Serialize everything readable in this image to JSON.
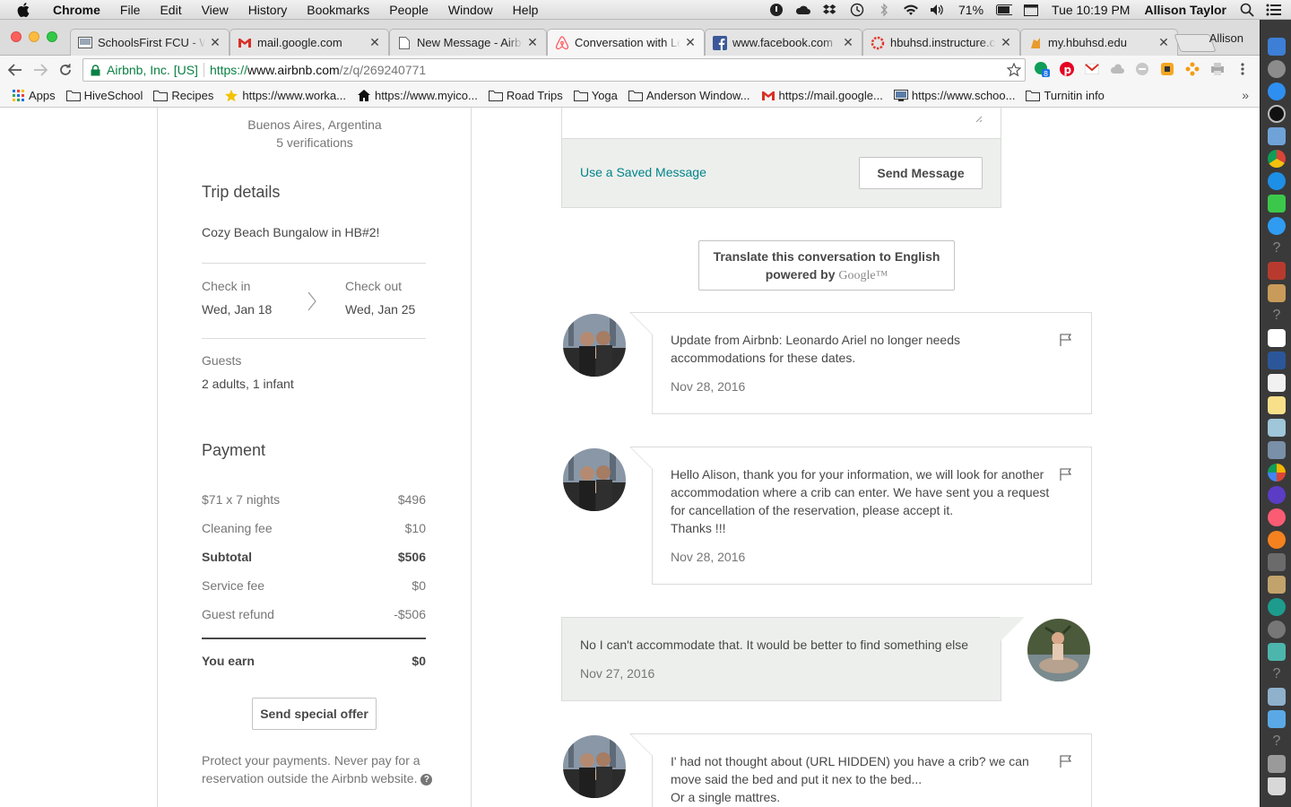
{
  "menubar": {
    "app": "Chrome",
    "items": [
      "File",
      "Edit",
      "View",
      "History",
      "Bookmarks",
      "People",
      "Window",
      "Help"
    ],
    "battery": "71%",
    "clock": "Tue 10:19 PM",
    "user": "Allison Taylor"
  },
  "tabs": [
    {
      "title": "SchoolsFirst FCU - W",
      "icon": "schoolsfirst-icon"
    },
    {
      "title": "mail.google.com",
      "icon": "gmail-icon"
    },
    {
      "title": "New Message - Airbnb",
      "icon": "document-icon"
    },
    {
      "title": "Conversation with Leonardo",
      "icon": "airbnb-icon",
      "active": true
    },
    {
      "title": "www.facebook.com",
      "icon": "facebook-icon"
    },
    {
      "title": "hbuhsd.instructure.com",
      "icon": "canvas-icon"
    },
    {
      "title": "my.hbuhsd.edu",
      "icon": "hbuhsd-icon"
    }
  ],
  "profile_name": "Allison",
  "address": {
    "org": "Airbnb, Inc. [US]",
    "scheme": "https://",
    "host": "www.airbnb.com",
    "path": "/z/q/269240771"
  },
  "bookmarks": [
    {
      "label": "Apps",
      "icon": "apps-grid-icon"
    },
    {
      "label": "HiveSchool",
      "icon": "folder-icon"
    },
    {
      "label": "Recipes",
      "icon": "folder-icon"
    },
    {
      "label": "https://www.worka...",
      "icon": "star-badge-icon"
    },
    {
      "label": "https://www.myico...",
      "icon": "house-icon"
    },
    {
      "label": "Road Trips",
      "icon": "folder-icon"
    },
    {
      "label": "Yoga",
      "icon": "folder-icon"
    },
    {
      "label": "Anderson Window...",
      "icon": "folder-icon"
    },
    {
      "label": "https://mail.google...",
      "icon": "gmail-icon"
    },
    {
      "label": "https://www.schoo...",
      "icon": "monitor-icon"
    },
    {
      "label": "Turnitin info",
      "icon": "folder-icon"
    }
  ],
  "sidebar": {
    "location": "Buenos Aires, Argentina",
    "verifications": "5 verifications",
    "trip_heading": "Trip details",
    "listing": "Cozy Beach Bungalow in HB#2!",
    "checkin_label": "Check in",
    "checkin_date": "Wed, Jan 18",
    "checkout_label": "Check out",
    "checkout_date": "Wed, Jan 25",
    "guests_label": "Guests",
    "guests_value": "2 adults, 1 infant",
    "payment_heading": "Payment",
    "payment_rows": [
      {
        "label": "$71 x 7 nights",
        "value": "$496"
      },
      {
        "label": "Cleaning fee",
        "value": "$10"
      },
      {
        "label": "Subtotal",
        "value": "$506"
      },
      {
        "label": "Service fee",
        "value": "$0"
      },
      {
        "label": "Guest refund",
        "value": "-$506"
      }
    ],
    "earn_label": "You earn",
    "earn_value": "$0",
    "offer_button": "Send special offer",
    "protect_text": "Protect your payments. Never pay for a reservation outside the Airbnb website.",
    "help_glyph": "?"
  },
  "composer": {
    "saved_link": "Use a Saved Message",
    "send_button": "Send Message"
  },
  "translate": {
    "line1": "Translate this conversation to English",
    "line2": "powered by",
    "brand": "Google™"
  },
  "messages": [
    {
      "text": "Update from Airbnb: Leonardo Ariel no longer needs accommodations for these dates.",
      "date": "Nov 28, 2016"
    },
    {
      "text": "Hello Alison, thank you for your information, we will look for another accommodation where a crib can enter. We have sent you a request for cancellation of the reservation, please accept it.",
      "text2": "Thanks !!!",
      "date": "Nov 28, 2016"
    },
    {
      "text": "No I can't accommodate that. It would be better to find something else",
      "date": "Nov 27, 2016"
    },
    {
      "text": "I' had not thought about (URL HIDDEN) you have a crib? we can move said the bed and put it nex to the bed...",
      "text2": "Or a single mattres."
    }
  ],
  "colors": {
    "teal_link": "#008489",
    "secure_green": "#0b8043",
    "airbnb_red": "#ff5a5f"
  }
}
